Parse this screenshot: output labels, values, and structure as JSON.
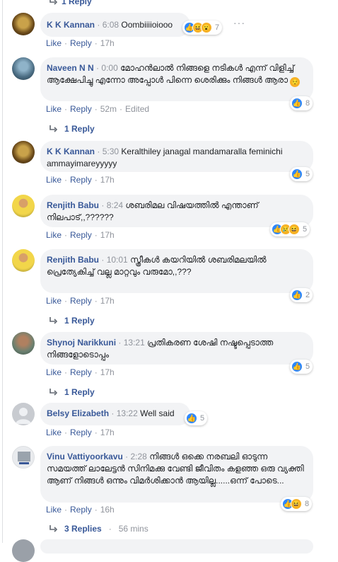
{
  "top_reply": {
    "label": "1 Reply"
  },
  "actions": {
    "like": "Like",
    "reply": "Reply",
    "sep": "·"
  },
  "comments": [
    {
      "author": "K K Kannan",
      "ts": "6:08",
      "text": "Oombiiiioiooo",
      "age": "17h",
      "reaction_count": "7"
    },
    {
      "author": "Naveen N N",
      "ts": "0:00",
      "text": "മോഹൻലാൽ നിങ്ങളെ നടികൾ എന്ന് വിളിച്ച് ആക്ഷേപിച്ചു എന്നോ അപ്പോൾ പിന്നെ ശെരിക്കും നിങ്ങൾ ആരാ",
      "age": "52m",
      "edited": "Edited",
      "reaction_count": "8",
      "replies": "1 Reply"
    },
    {
      "author": "K K Kannan",
      "ts": "5:30",
      "text": "Keralthiley janagal mandamaralla feminichi ammayimareyyyyy",
      "age": "17h",
      "reaction_count": "5"
    },
    {
      "author": "Renjith Babu",
      "ts": "8:24",
      "text": "ശബരിമല വിഷയത്തിൽ എന്താണ് നിലപാട്,,??????",
      "age": "17h",
      "reaction_count": "5"
    },
    {
      "author": "Renjith Babu",
      "ts": "10:01",
      "text": "സ്ത്രീകൾ കയറിയിൽ ശബരിമലയിൽ പ്രെത്യേകിച്ച് വല്ല മാറ്റവും വരുമോ,,???",
      "age": "17h",
      "reaction_count": "2",
      "replies": "1 Reply"
    },
    {
      "author": "Shynoj Narikkuni",
      "ts": "13:21",
      "text": "പ്രതികരണ ശേഷി നഷ്ടപ്പെടാത്ത നിങ്ങളോടൊപ്പം",
      "age": "17h",
      "reaction_count": "5",
      "replies": "1 Reply"
    },
    {
      "author": "Belsy Elizabeth",
      "ts": "13:22",
      "text": "Well said",
      "age": "17h",
      "reaction_count": "5"
    },
    {
      "author": "Vinu Vattiyoorkavu",
      "ts": "2:28",
      "text": "നിങ്ങൾ ഒക്കെ നരബലി ഓടുന്ന സമയത്ത് ലാലേട്ടൻ സിനിമക്കു വേണ്ടി ജീവിതം കളഞ്ഞ ഒരു വ്യക്തി ആണ് നിങ്ങൾ ഒന്നും വിമർശിക്കാൻ ആയില്ല......ഒന്ന് പോടെ...",
      "age": "16h",
      "reaction_count": "8",
      "replies": "3 Replies",
      "replies_age": "56 mins"
    }
  ],
  "colors": {
    "link": "#385898",
    "meta": "#90949c",
    "bubble": "#f2f3f5",
    "like": "#2d88ff",
    "emoji": "#f7b125"
  }
}
